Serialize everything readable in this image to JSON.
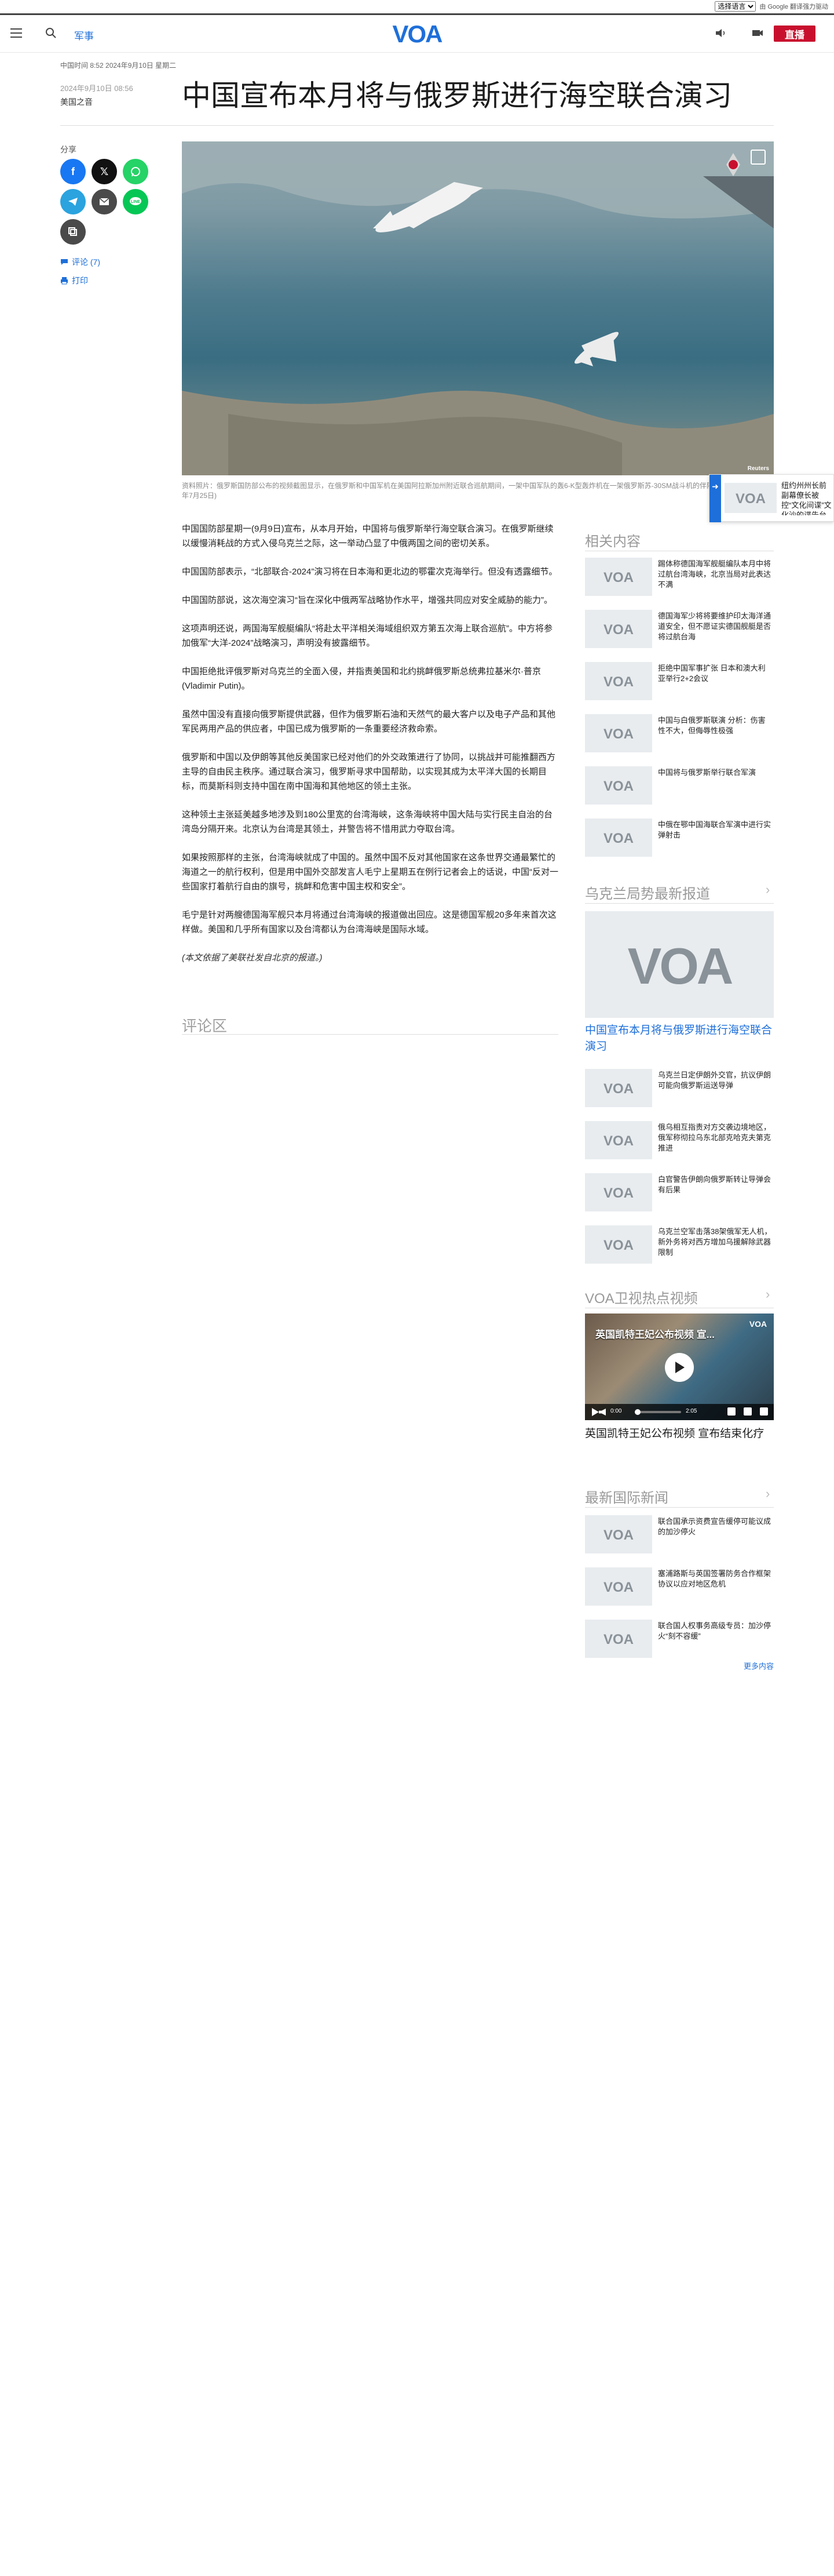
{
  "translate": {
    "select_value": "选择语言",
    "powered": "由 Google 翻译强力驱动"
  },
  "header": {
    "section": "军事",
    "live_label": "直播"
  },
  "article": {
    "timeinfo": "中国时间 8:52 2024年9月10日 星期二",
    "date": "2024年9月10日 08:56",
    "author": "美国之音",
    "title": "中国宣布本月将与俄罗斯进行海空联合演习",
    "share_label": "分享",
    "comments_link": "评论 (7)",
    "print_link": "打印",
    "hero_credit": "Reuters",
    "caption": "资料照片：俄罗斯国防部公布的视频截图显示，在俄罗斯和中国军机在美国阿拉斯加州附近联合巡航期间，一架中国军队的轰6-K型轰炸机在一架俄罗斯苏-30SM战斗机的伴随下飞行。(2024年7月25日)",
    "paragraphs": [
      "中国国防部星期一(9月9日)宣布，从本月开始，中国将与俄罗斯举行海空联合演习。在俄罗斯继续以缓慢消耗战的方式入侵乌克兰之际，这一举动凸显了中俄两国之间的密切关系。",
      "中国国防部表示，“北部联合-2024”演习将在日本海和更北边的鄂霍次克海举行。但没有透露细节。",
      "中国国防部说，这次海空演习“旨在深化中俄两军战略协作水平，增强共同应对安全威胁的能力”。",
      "这项声明还说，两国海军舰艇编队“将赴太平洋相关海域组织双方第五次海上联合巡航”。中方将参加俄军“大洋-2024”战略演习，声明没有披露细节。",
      "中国拒绝批评俄罗斯对乌克兰的全面入侵，并指责美国和北约挑衅俄罗斯总统弗拉基米尔·普京(Vladimir Putin)。",
      "虽然中国没有直接向俄罗斯提供武器，但作为俄罗斯石油和天然气的最大客户以及电子产品和其他军民两用产品的供应者，中国已成为俄罗斯的一条重要经济救命索。",
      "俄罗斯和中国以及伊朗等其他反美国家已经对他们的外交政策进行了协同，以挑战并可能推翻西方主导的自由民主秩序。通过联合演习，俄罗斯寻求中国帮助，以实现其成为太平洋大国的长期目标，而莫斯科则支持中国在南中国海和其他地区的领土主张。",
      "这种领土主张延美越多地涉及到180公里宽的台湾海峡，这条海峡将中国大陆与实行民主自治的台湾岛分隔开来。北京认为台湾是其领土，并警告将不惜用武力夺取台湾。",
      "如果按照那样的主张，台湾海峡就成了中国的。虽然中国不反对其他国家在这条世界交通最繁忙的海道之一的航行权利，但是用中国外交部发言人毛宁上星期五在例行记者会上的话说，中国“反对一些国家打着航行自由的旗号，挑衅和危害中国主权和安全”。",
      "毛宁是针对两艘德国海军舰只本月将通过台湾海峡的报道做出回应。这是德国军舰20多年来首次这样做。美国和几乎所有国家以及台湾都认为台湾海峡是国际水域。"
    ],
    "note": "(本文依据了美联社发自北京的报道。)",
    "comments_title": "评论区"
  },
  "float_card": {
    "text": "纽约州州长前副幕僚长被控“文化间谍”文化沙的谍告台湾裁美国国务院"
  },
  "rail": {
    "related_title": "相关内容",
    "related": [
      "踢体称德国海军舰艇编队本月中将过航台湾海峡，北京当局对此表达不满",
      "德国海军少将将要维护印太海洋通道安全，但不愿证实德国舰艇是否将过航台海",
      "拒绝中国军事扩张 日本和澳大利亚举行2+2会议",
      "中国与白俄罗斯联演 分析：伤害性不大，但侮辱性极强",
      "中国将与俄罗斯举行联合军演",
      "中俄在鄂中国海联合军演中进行实弹射击"
    ],
    "ukraine_title": "乌克兰局势最新报道",
    "ukraine_feature": "中国宣布本月将与俄罗斯进行海空联合演习",
    "ukraine": [
      "乌克兰日定伊朗外交官，抗议伊朗可能向俄罗斯运送导弹",
      "俄乌相互指责对方交袭边境地区，俄军称彻拉乌东北部克哈克夫第克推进",
      "白官警告伊朗向俄罗斯转让导弹会有后果",
      "乌克兰空军击落38架俄军无人机，新外务将对西方增加乌援解除武器限制"
    ],
    "video_title": "VOA卫视热点视频",
    "video_overlay": "英国凯特王妃公布视频 宣...",
    "video_time": "0:00",
    "video_duration": "2:05",
    "video_caption": "英国凯特王妃公布视频 宣布结束化疗",
    "intl_title": "最新国际新闻",
    "intl": [
      "联合国承示资费宣告缓停可能议成的加沙停火",
      "塞浦路斯与英国签署防务合作框架协议以应对地区危机",
      "联合国人权事务高级专员：加沙停火“刻不容缓”"
    ],
    "more_label": "更多内容"
  },
  "colors": {
    "brand": "#1e6fd9",
    "live": "#c8102e"
  }
}
